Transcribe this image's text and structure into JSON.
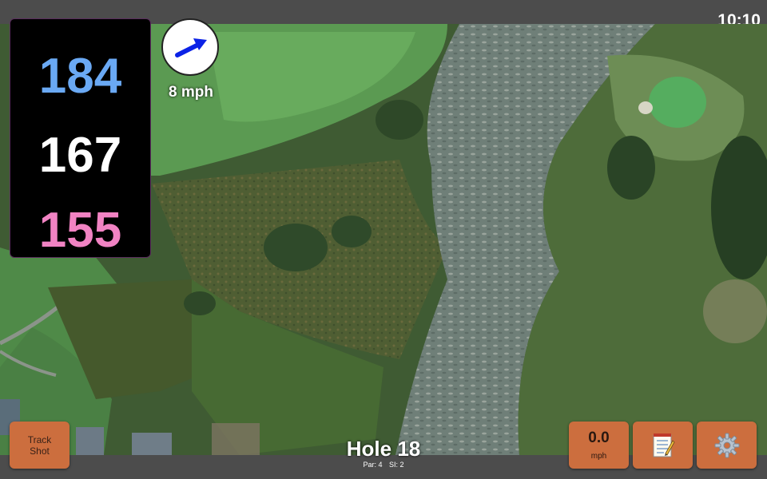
{
  "status": {
    "time": "10:10"
  },
  "distances": {
    "back": "184",
    "middle": "167",
    "front": "155",
    "colors": {
      "back": "#6aa9f4",
      "middle": "#ffffff",
      "front": "#f183c3"
    }
  },
  "wind": {
    "speed": "8 mph",
    "arrow_color": "#0b22e6"
  },
  "hole": {
    "title": "Hole 18",
    "par": "Par: 4",
    "si": "SI: 2"
  },
  "buttons": {
    "track_shot": "Track Shot",
    "speed_value": "0.0",
    "speed_unit": "mph",
    "notes_icon": "notepad-icon",
    "settings_icon": "gear-icon"
  },
  "accent_color": "#cc6e3e"
}
